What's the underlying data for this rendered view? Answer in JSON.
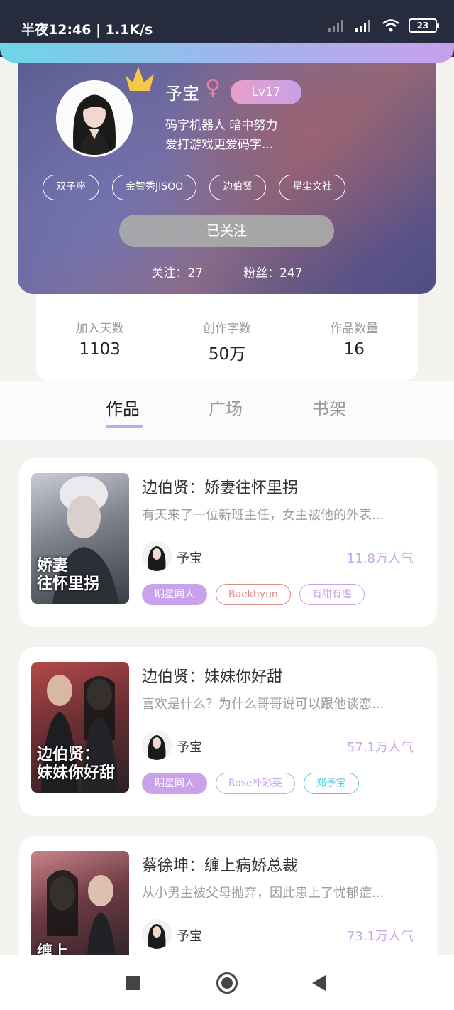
{
  "status_bar": {
    "time": "半夜12:46 | 1.1K/s",
    "battery": "23"
  },
  "profile": {
    "name": "予宝",
    "gender_symbol": "♀",
    "level": "Lv17",
    "bio_line1": "码字机器人 暗中努力",
    "bio_line2": "爱打游戏更爱码字...",
    "tags": [
      "双子座",
      "金智秀JISOO",
      "边伯贤",
      "星尘文社"
    ],
    "follow_button": "已关注",
    "following": "关注：27",
    "followers": "粉丝：247"
  },
  "stats": [
    {
      "label": "加入天数",
      "value": "1103"
    },
    {
      "label": "创作字数",
      "value": "50万"
    },
    {
      "label": "作品数量",
      "value": "16"
    }
  ],
  "tabs": [
    "作品",
    "广场",
    "书架"
  ],
  "active_tab": "作品",
  "books": [
    {
      "title": "边伯贤：娇妻往怀里拐",
      "description": "有天来了一位新班主任，女主被他的外表...",
      "author": "予宝",
      "popularity": "11.8万人气",
      "cover_text_1": "娇妻",
      "cover_text_2": "往怀里拐",
      "tags": [
        {
          "label": "明星同人",
          "style": "filled",
          "color": "#c9a2ec"
        },
        {
          "label": "Baekhyun",
          "style": "outline",
          "color": "#e08a86"
        },
        {
          "label": "有甜有虐",
          "style": "outline",
          "color": "#c9a2ec"
        }
      ]
    },
    {
      "title": "边伯贤：妹妹你好甜",
      "description": "喜欢是什么？为什么哥哥说可以跟他谈恋...",
      "author": "予宝",
      "popularity": "57.1万人气",
      "cover_text_1": "边伯贤：",
      "cover_text_2": "妹妹你好甜",
      "tags": [
        {
          "label": "明星同人",
          "style": "filled",
          "color": "#c9a2ec"
        },
        {
          "label": "Rose朴彩英",
          "style": "outline",
          "color": "#c9a2ec"
        },
        {
          "label": "郑予宝",
          "style": "outline",
          "color": "#5ec8de"
        }
      ]
    },
    {
      "title": "蔡徐坤：缠上病娇总裁",
      "description": "从小男主被父母抛弃，因此患上了忧郁症...",
      "author": "予宝",
      "popularity": "73.1万人气",
      "cover_text_1": "缠上",
      "cover_text_2": "",
      "tags": []
    }
  ],
  "nav": {
    "icons": [
      "recent-apps-icon",
      "home-icon",
      "back-icon"
    ]
  }
}
